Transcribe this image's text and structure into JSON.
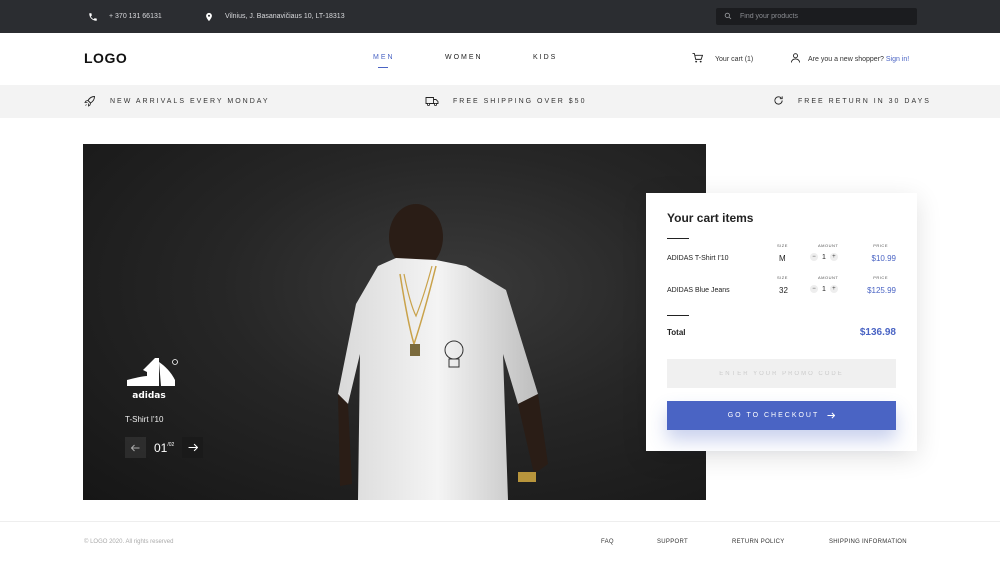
{
  "topbar": {
    "phone": "+ 370 131 66131",
    "address": "Vilnius, J. Basanavičiaus 10, LT-18313",
    "search_placeholder": "Find your products",
    "icons": [
      "phone-icon",
      "location-pin-icon",
      "search-icon"
    ]
  },
  "header": {
    "logo": "LOGO",
    "nav": [
      {
        "label": "MEN",
        "active": true
      },
      {
        "label": "WOMEN",
        "active": false
      },
      {
        "label": "KIDS",
        "active": false
      }
    ],
    "cart_label": "Your cart (1)",
    "shopper_text": "Are you a new shopper?",
    "signin_label": "Sign in!"
  },
  "promos": [
    {
      "icon": "rocket-icon",
      "text": "NEW ARRIVALS EVERY MONDAY"
    },
    {
      "icon": "truck-icon",
      "text": "FREE SHIPPING OVER $50"
    },
    {
      "icon": "refresh-icon",
      "text": "FREE RETURN IN 30 DAYS"
    }
  ],
  "hero": {
    "brand_logo_text": "adidas",
    "product_name": "T-Shirt I'10",
    "slide_current": "01",
    "slide_total": "/02"
  },
  "cart": {
    "title": "Your cart items",
    "col_size": "SIZE",
    "col_amount": "AMOUNT",
    "col_price": "PRICE",
    "items": [
      {
        "name": "ADIDAS T-Shirt I'10",
        "size": "M",
        "qty": "1",
        "price": "$10.99"
      },
      {
        "name": "ADIDAS Blue Jeans",
        "size": "32",
        "qty": "1",
        "price": "$125.99"
      }
    ],
    "total_label": "Total",
    "total_value": "$136.98",
    "promo_placeholder": "ENTER YOUR PROMO CODE",
    "checkout_label": "GO TO CHECKOUT"
  },
  "footer": {
    "copyright": "© LOGO 2020. All rights reserved",
    "links": [
      "FAQ",
      "SUPPORT",
      "RETURN POLICY",
      "SHIPPING INFORMATION"
    ]
  },
  "colors": {
    "accent": "#4a64c4",
    "topbar": "#2b2d31",
    "promo_bar": "#f3f3f3"
  }
}
